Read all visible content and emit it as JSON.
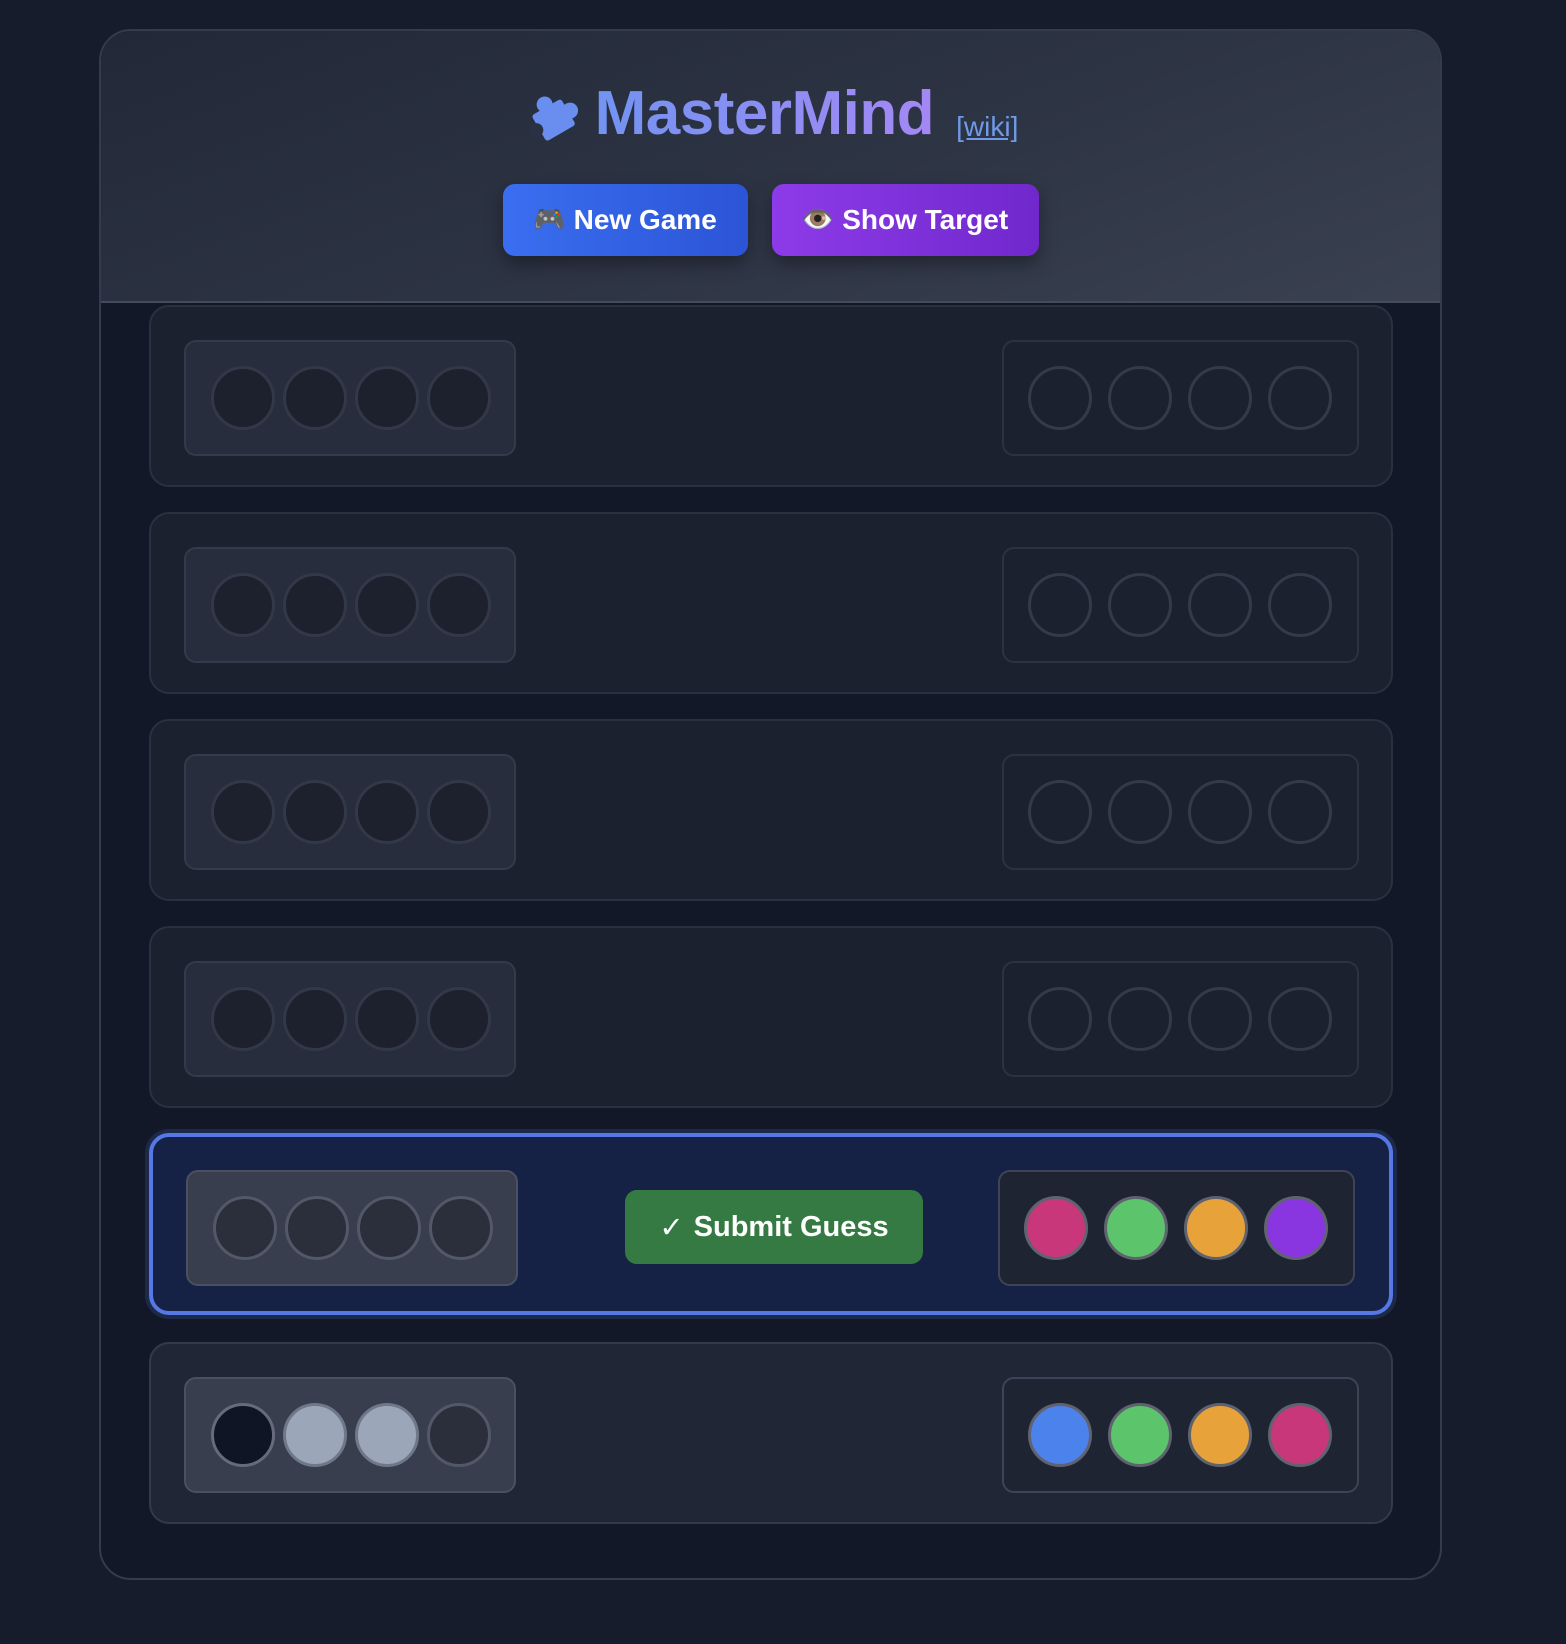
{
  "header": {
    "title": "MasterMind",
    "wiki_link": "[wiki]",
    "icon": "puzzle-piece-icon",
    "new_game": {
      "icon": "🎮",
      "label": "New Game"
    },
    "show_target": {
      "icon": "👁️",
      "label": "Show Target"
    }
  },
  "submit": {
    "icon": "✓",
    "label": "Submit Guess"
  },
  "colors": {
    "pink": "#c8377a",
    "green": "#5cc46b",
    "orange": "#e8a23a",
    "purple": "#8a36e0",
    "blue": "#4b82ec"
  },
  "rows": [
    {
      "state": "empty",
      "feedback": [
        "empty",
        "empty",
        "empty",
        "empty"
      ],
      "guess": [
        null,
        null,
        null,
        null
      ]
    },
    {
      "state": "empty",
      "feedback": [
        "empty",
        "empty",
        "empty",
        "empty"
      ],
      "guess": [
        null,
        null,
        null,
        null
      ]
    },
    {
      "state": "empty",
      "feedback": [
        "empty",
        "empty",
        "empty",
        "empty"
      ],
      "guess": [
        null,
        null,
        null,
        null
      ]
    },
    {
      "state": "empty",
      "feedback": [
        "empty",
        "empty",
        "empty",
        "empty"
      ],
      "guess": [
        null,
        null,
        null,
        null
      ]
    },
    {
      "state": "active",
      "feedback": [
        "empty",
        "empty",
        "empty",
        "empty"
      ],
      "guess": [
        "pink",
        "green",
        "orange",
        "purple"
      ]
    },
    {
      "state": "done",
      "feedback": [
        "black",
        "white",
        "white",
        "empty"
      ],
      "guess": [
        "blue",
        "green",
        "orange",
        "pink"
      ]
    }
  ]
}
